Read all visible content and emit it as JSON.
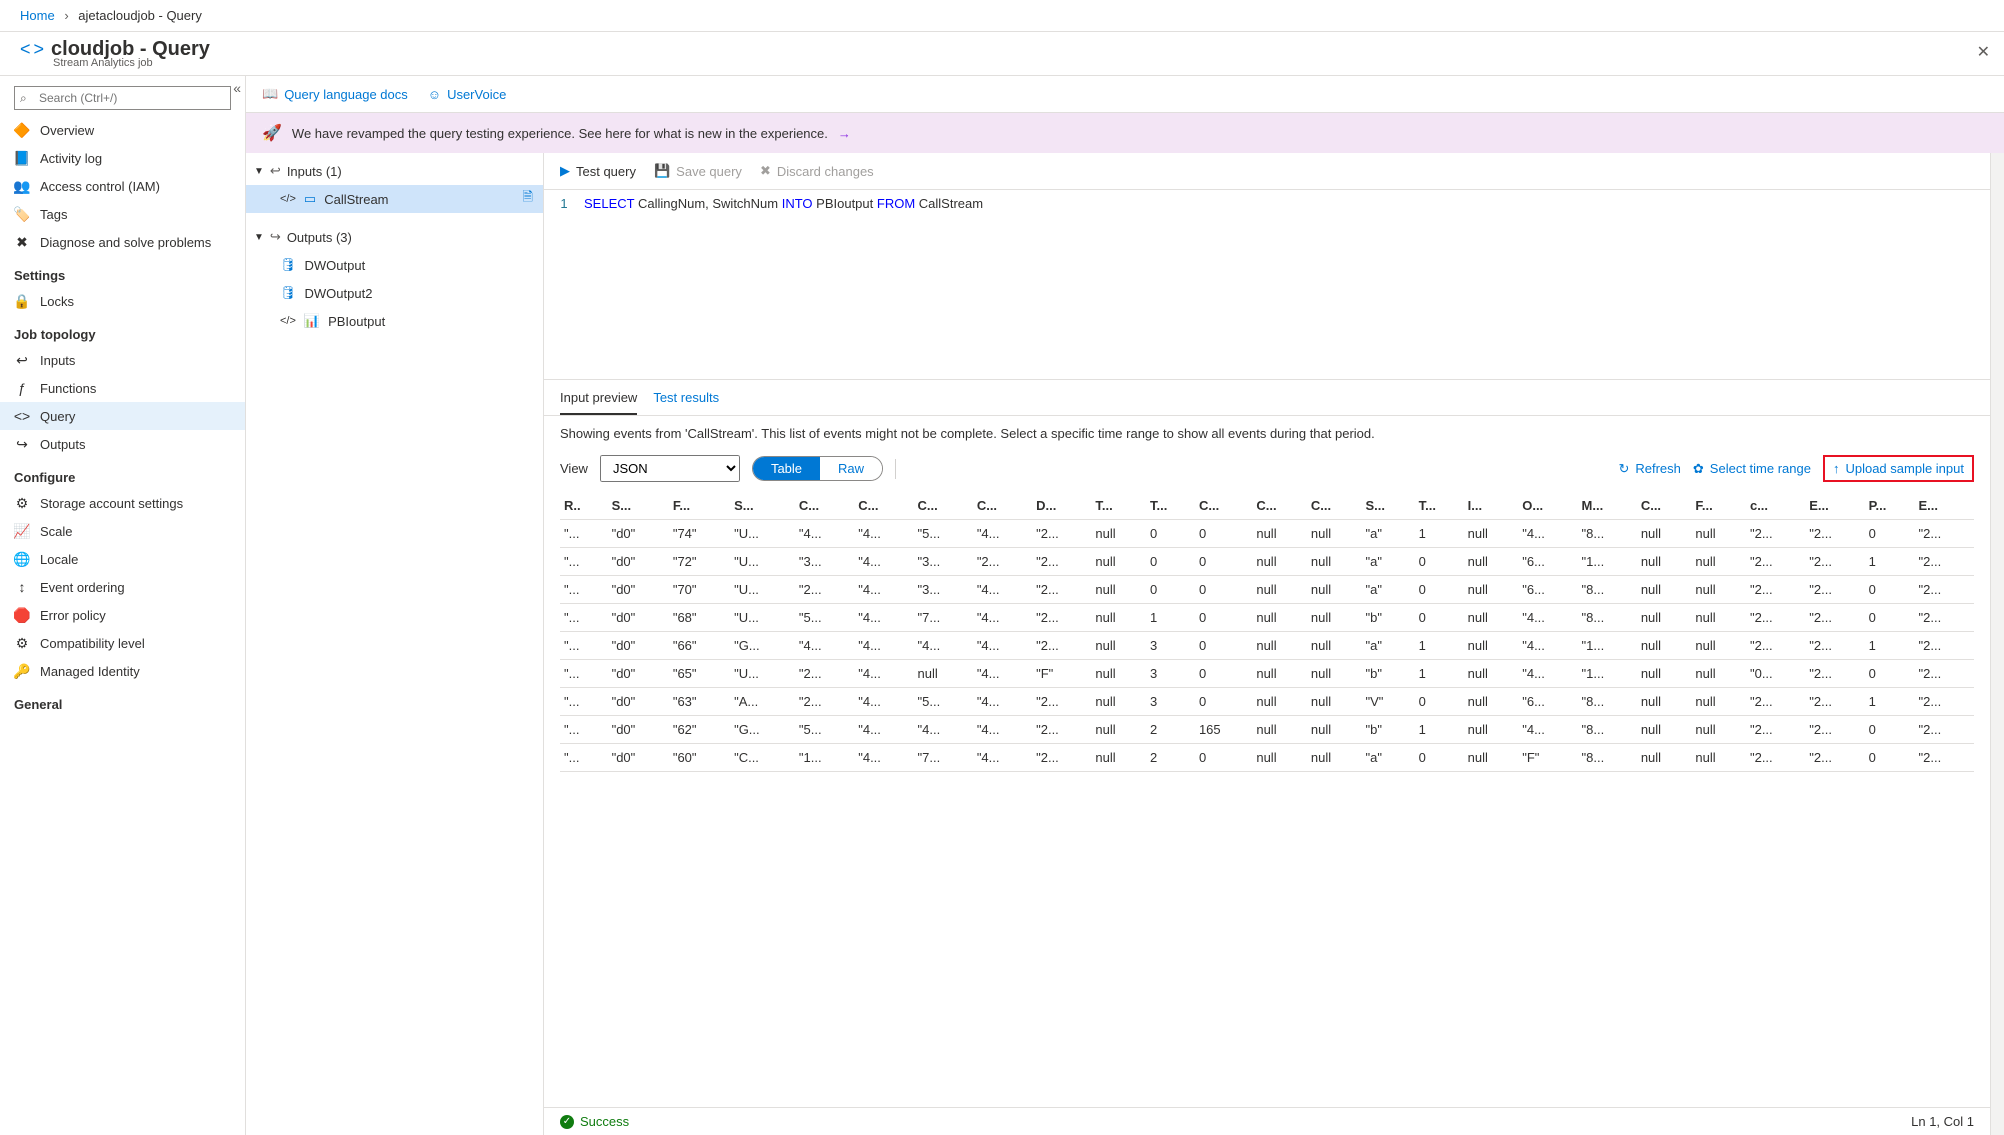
{
  "breadcrumb": {
    "home": "Home",
    "path": "ajetacloudjob - Query"
  },
  "header": {
    "title": "cloudjob - Query",
    "subtitle": "Stream Analytics job"
  },
  "search": {
    "placeholder": "Search (Ctrl+/)"
  },
  "nav": {
    "items_top": [
      {
        "label": "Overview",
        "icon": "🔶",
        "name": "nav-overview"
      },
      {
        "label": "Activity log",
        "icon": "📘",
        "name": "nav-activity-log"
      },
      {
        "label": "Access control (IAM)",
        "icon": "👥",
        "name": "nav-access-control"
      },
      {
        "label": "Tags",
        "icon": "🏷️",
        "name": "nav-tags"
      },
      {
        "label": "Diagnose and solve problems",
        "icon": "✖",
        "name": "nav-diagnose"
      }
    ],
    "section_settings": "Settings",
    "items_settings": [
      {
        "label": "Locks",
        "icon": "🔒",
        "name": "nav-locks"
      }
    ],
    "section_topology": "Job topology",
    "items_topology": [
      {
        "label": "Inputs",
        "icon": "↩",
        "name": "nav-inputs"
      },
      {
        "label": "Functions",
        "icon": "ƒ",
        "name": "nav-functions"
      },
      {
        "label": "Query",
        "icon": "<>",
        "name": "nav-query",
        "selected": true
      },
      {
        "label": "Outputs",
        "icon": "↪",
        "name": "nav-outputs"
      }
    ],
    "section_configure": "Configure",
    "items_configure": [
      {
        "label": "Storage account settings",
        "icon": "⚙",
        "name": "nav-storage"
      },
      {
        "label": "Scale",
        "icon": "📈",
        "name": "nav-scale"
      },
      {
        "label": "Locale",
        "icon": "🌐",
        "name": "nav-locale"
      },
      {
        "label": "Event ordering",
        "icon": "↕",
        "name": "nav-event-ordering"
      },
      {
        "label": "Error policy",
        "icon": "🛑",
        "name": "nav-error-policy"
      },
      {
        "label": "Compatibility level",
        "icon": "⚙",
        "name": "nav-compat"
      },
      {
        "label": "Managed Identity",
        "icon": "🔑",
        "name": "nav-identity"
      }
    ],
    "section_general": "General"
  },
  "toolbar": {
    "docs": "Query language docs",
    "uservoice": "UserVoice"
  },
  "banner": {
    "text": "We have revamped the query testing experience. See here for what is new in the experience."
  },
  "tree": {
    "inputs_header": "Inputs (1)",
    "inputs": [
      {
        "label": "CallStream",
        "selected": true
      }
    ],
    "outputs_header": "Outputs (3)",
    "outputs": [
      {
        "label": "DWOutput"
      },
      {
        "label": "DWOutput2"
      },
      {
        "label": "PBIoutput"
      }
    ]
  },
  "query_toolbar": {
    "test": "Test query",
    "save": "Save query",
    "discard": "Discard changes"
  },
  "code": {
    "line_num": "1",
    "p1": "SELECT",
    "p2": " CallingNum, SwitchNum ",
    "p3": "INTO",
    "p4": " PBIoutput ",
    "p5": "FROM",
    "p6": " CallStream"
  },
  "tabs": {
    "preview": "Input preview",
    "results": "Test results"
  },
  "preview": {
    "msg": "Showing events from 'CallStream'. This list of events might not be complete. Select a specific time range to show all events during that period.",
    "view_label": "View",
    "view_value": "JSON",
    "toggle_table": "Table",
    "toggle_raw": "Raw",
    "refresh": "Refresh",
    "select_range": "Select time range",
    "upload": "Upload sample input"
  },
  "table": {
    "headers": [
      "R..",
      "S...",
      "F...",
      "S...",
      "C...",
      "C...",
      "C...",
      "C...",
      "D...",
      "T...",
      "T...",
      "C...",
      "C...",
      "C...",
      "S...",
      "T...",
      "I...",
      "O...",
      "M...",
      "C...",
      "F...",
      "c...",
      "E...",
      "P...",
      "E..."
    ],
    "rows": [
      [
        "\"...",
        "\"d0\"",
        "\"74\"",
        "\"U...",
        "\"4...",
        "\"4...",
        "\"5...",
        "\"4...",
        "\"2...",
        "null",
        "0",
        "0",
        "null",
        "null",
        "\"a\"",
        "1",
        "null",
        "\"4...",
        "\"8...",
        "null",
        "null",
        "\"2...",
        "\"2...",
        "0",
        "\"2..."
      ],
      [
        "\"...",
        "\"d0\"",
        "\"72\"",
        "\"U...",
        "\"3...",
        "\"4...",
        "\"3...",
        "\"2...",
        "\"2...",
        "null",
        "0",
        "0",
        "null",
        "null",
        "\"a\"",
        "0",
        "null",
        "\"6...",
        "\"1...",
        "null",
        "null",
        "\"2...",
        "\"2...",
        "1",
        "\"2..."
      ],
      [
        "\"...",
        "\"d0\"",
        "\"70\"",
        "\"U...",
        "\"2...",
        "\"4...",
        "\"3...",
        "\"4...",
        "\"2...",
        "null",
        "0",
        "0",
        "null",
        "null",
        "\"a\"",
        "0",
        "null",
        "\"6...",
        "\"8...",
        "null",
        "null",
        "\"2...",
        "\"2...",
        "0",
        "\"2..."
      ],
      [
        "\"...",
        "\"d0\"",
        "\"68\"",
        "\"U...",
        "\"5...",
        "\"4...",
        "\"7...",
        "\"4...",
        "\"2...",
        "null",
        "1",
        "0",
        "null",
        "null",
        "\"b\"",
        "0",
        "null",
        "\"4...",
        "\"8...",
        "null",
        "null",
        "\"2...",
        "\"2...",
        "0",
        "\"2..."
      ],
      [
        "\"...",
        "\"d0\"",
        "\"66\"",
        "\"G...",
        "\"4...",
        "\"4...",
        "\"4...",
        "\"4...",
        "\"2...",
        "null",
        "3",
        "0",
        "null",
        "null",
        "\"a\"",
        "1",
        "null",
        "\"4...",
        "\"1...",
        "null",
        "null",
        "\"2...",
        "\"2...",
        "1",
        "\"2..."
      ],
      [
        "\"...",
        "\"d0\"",
        "\"65\"",
        "\"U...",
        "\"2...",
        "\"4...",
        "null",
        "\"4...",
        "\"F\"",
        "null",
        "3",
        "0",
        "null",
        "null",
        "\"b\"",
        "1",
        "null",
        "\"4...",
        "\"1...",
        "null",
        "null",
        "\"0...",
        "\"2...",
        "0",
        "\"2..."
      ],
      [
        "\"...",
        "\"d0\"",
        "\"63\"",
        "\"A...",
        "\"2...",
        "\"4...",
        "\"5...",
        "\"4...",
        "\"2...",
        "null",
        "3",
        "0",
        "null",
        "null",
        "\"V\"",
        "0",
        "null",
        "\"6...",
        "\"8...",
        "null",
        "null",
        "\"2...",
        "\"2...",
        "1",
        "\"2..."
      ],
      [
        "\"...",
        "\"d0\"",
        "\"62\"",
        "\"G...",
        "\"5...",
        "\"4...",
        "\"4...",
        "\"4...",
        "\"2...",
        "null",
        "2",
        "165",
        "null",
        "null",
        "\"b\"",
        "1",
        "null",
        "\"4...",
        "\"8...",
        "null",
        "null",
        "\"2...",
        "\"2...",
        "0",
        "\"2..."
      ],
      [
        "\"...",
        "\"d0\"",
        "\"60\"",
        "\"C...",
        "\"1...",
        "\"4...",
        "\"7...",
        "\"4...",
        "\"2...",
        "null",
        "2",
        "0",
        "null",
        "null",
        "\"a\"",
        "0",
        "null",
        "\"F\"",
        "\"8...",
        "null",
        "null",
        "\"2...",
        "\"2...",
        "0",
        "\"2..."
      ]
    ]
  },
  "status": {
    "ok": "Success",
    "pos": "Ln 1, Col 1"
  }
}
